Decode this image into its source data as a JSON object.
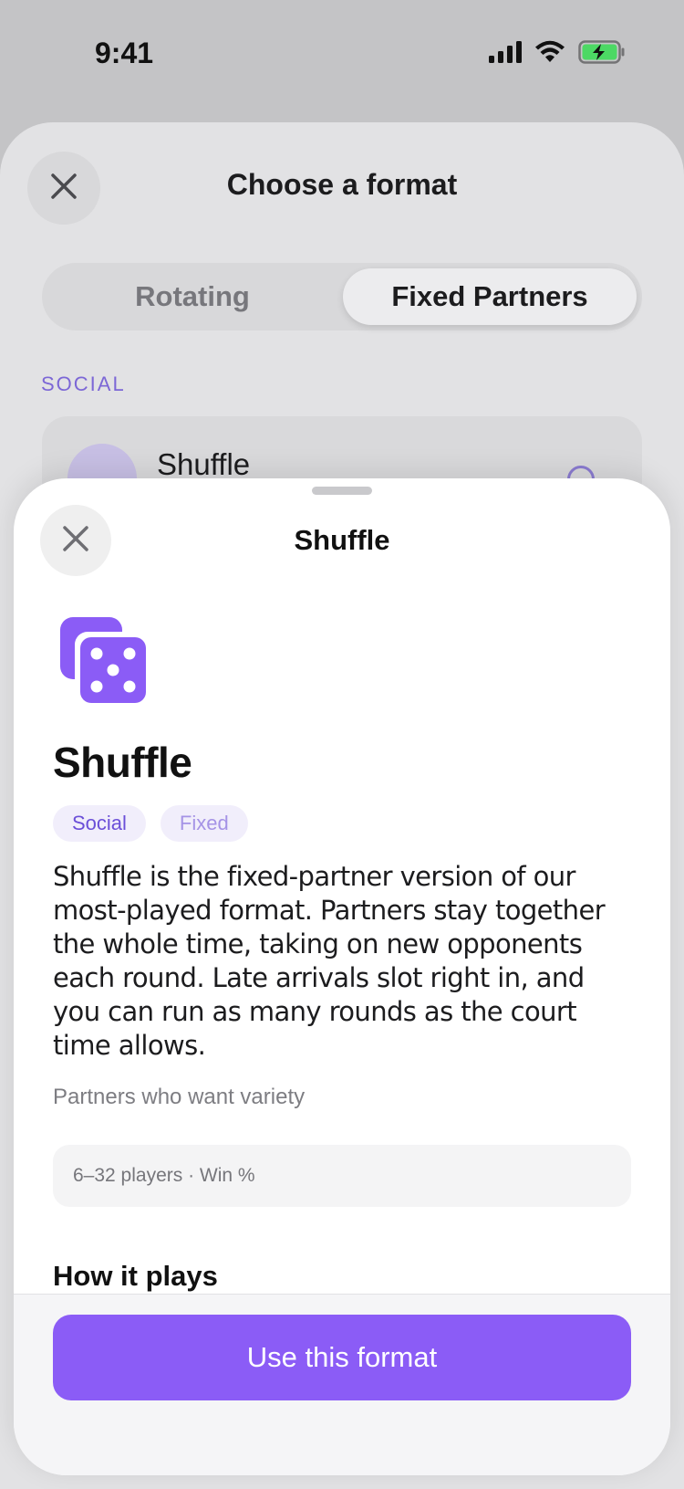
{
  "status_bar": {
    "time": "9:41",
    "icons": [
      "signal-icon",
      "wifi-icon",
      "battery-charging-icon"
    ]
  },
  "background_sheet": {
    "title": "Choose a format",
    "segmented": {
      "options": [
        "Rotating",
        "Fixed Partners"
      ],
      "selected": "Fixed Partners"
    },
    "section_label": "SOCIAL",
    "card": {
      "title": "Shuffle"
    }
  },
  "detail_sheet": {
    "header_title": "Shuffle",
    "format_name": "Shuffle",
    "tags": [
      "Social",
      "Fixed"
    ],
    "description": "Shuffle is the fixed-partner version of our most-played format. Partners stay together the whole time, taking on new opponents each round. Late arrivals slot right in, and you can run as many rounds as the court time allows.",
    "audience": "Partners who want variety",
    "info": "6–32 players · Win %",
    "section_heading": "How it plays",
    "cta_label": "Use this format"
  },
  "colors": {
    "accent": "#8b5cf6",
    "tag_background": "#f1eefb",
    "tag_text": "#6b4fd8"
  }
}
